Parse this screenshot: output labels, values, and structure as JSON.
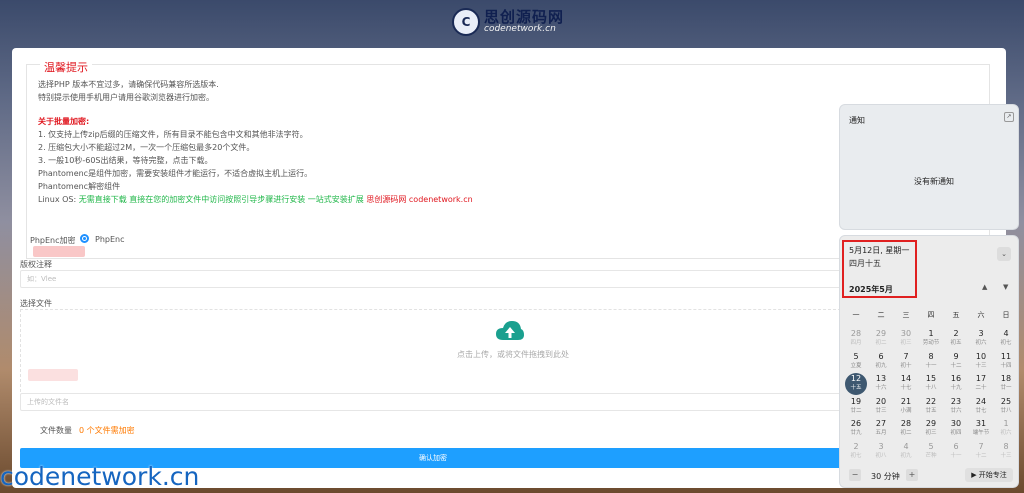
{
  "logo": {
    "cn": "思创源码网",
    "en": "codenetwork.cn"
  },
  "legend": "温馨提示",
  "tips": [
    "选择PHP 版本不宜过多，请确保代码兼容所选版本.",
    "特别提示使用手机用户请用谷歌浏览器进行加密。"
  ],
  "batch": {
    "title": "关于批量加密:",
    "lines": [
      "1. 仅支持上传zip后缀的压缩文件，所有目录不能包含中文和其他非法字符。",
      "2. 压缩包大小不能超过2M，一次一个压缩包最多20个文件。",
      "3. 一般10秒-60S出结果，等待完整，点击下载。",
      "Phantomenc是组件加密，需要安装组件才能运行，不适合虚拟主机上运行。",
      "Phantomenc解密组件"
    ],
    "linux_label": "Linux OS: ",
    "linux_green": "无需直接下载 直接在您的加密文件中访问按照引导步骤进行安装 一站式安装扩展 ",
    "linux_red": "思创源码网 codenetwork.cn"
  },
  "form": {
    "enc_label": "PhpEnc加密",
    "radio_label": "PhpEnc",
    "copyright_label": "版权注释",
    "copyright_placeholder": "如：Vlee",
    "file_label": "选择文件",
    "upload_hint": "点击上传，或将文件拖拽到此处",
    "filename_placeholder": "上传的文件名",
    "count_label": "文件数量",
    "count_value": "0 个文件需加密",
    "submit": "确认加密"
  },
  "notification": {
    "title": "通知",
    "empty": "没有新通知"
  },
  "calendar": {
    "date_line": "5月12日, 星期一",
    "lunar_line": "四月十五",
    "month": "2025年5月",
    "weekdays": [
      "一",
      "二",
      "三",
      "四",
      "五",
      "六",
      "日"
    ],
    "rows": [
      [
        [
          "28",
          "四月",
          1
        ],
        [
          "29",
          "初二",
          1
        ],
        [
          "30",
          "初三",
          1
        ],
        [
          "1",
          "劳动节",
          0
        ],
        [
          "2",
          "初五",
          0
        ],
        [
          "3",
          "初六",
          0
        ],
        [
          "4",
          "初七",
          0
        ]
      ],
      [
        [
          "5",
          "立夏",
          0
        ],
        [
          "6",
          "初九",
          0
        ],
        [
          "7",
          "初十",
          0
        ],
        [
          "8",
          "十一",
          0
        ],
        [
          "9",
          "十二",
          0
        ],
        [
          "10",
          "十三",
          0
        ],
        [
          "11",
          "十四",
          0
        ]
      ],
      [
        [
          "12",
          "十五",
          2
        ],
        [
          "13",
          "十六",
          0
        ],
        [
          "14",
          "十七",
          0
        ],
        [
          "15",
          "十八",
          0
        ],
        [
          "16",
          "十九",
          0
        ],
        [
          "17",
          "二十",
          0
        ],
        [
          "18",
          "廿一",
          0
        ]
      ],
      [
        [
          "19",
          "廿二",
          0
        ],
        [
          "20",
          "廿三",
          0
        ],
        [
          "21",
          "小满",
          0
        ],
        [
          "22",
          "廿五",
          0
        ],
        [
          "23",
          "廿六",
          0
        ],
        [
          "24",
          "廿七",
          0
        ],
        [
          "25",
          "廿八",
          0
        ]
      ],
      [
        [
          "26",
          "廿九",
          0
        ],
        [
          "27",
          "五月",
          0
        ],
        [
          "28",
          "初二",
          0
        ],
        [
          "29",
          "初三",
          0
        ],
        [
          "30",
          "初四",
          0
        ],
        [
          "31",
          "端午节",
          0
        ],
        [
          "1",
          "初六",
          1
        ]
      ],
      [
        [
          "2",
          "初七",
          1
        ],
        [
          "3",
          "初八",
          1
        ],
        [
          "4",
          "初九",
          1
        ],
        [
          "5",
          "芒种",
          1
        ],
        [
          "6",
          "十一",
          1
        ],
        [
          "7",
          "十二",
          1
        ],
        [
          "8",
          "十三",
          1
        ]
      ]
    ],
    "focus_minutes": "30 分钟",
    "focus_minus": "−",
    "focus_plus": "+",
    "focus_start": "▶ 开始专注"
  },
  "watermark": "codenetwork.cn",
  "colors": {
    "accent": "#1e9fff",
    "warn": "#e0161e",
    "ok": "#21b74a",
    "upload": "#1aa08f"
  }
}
